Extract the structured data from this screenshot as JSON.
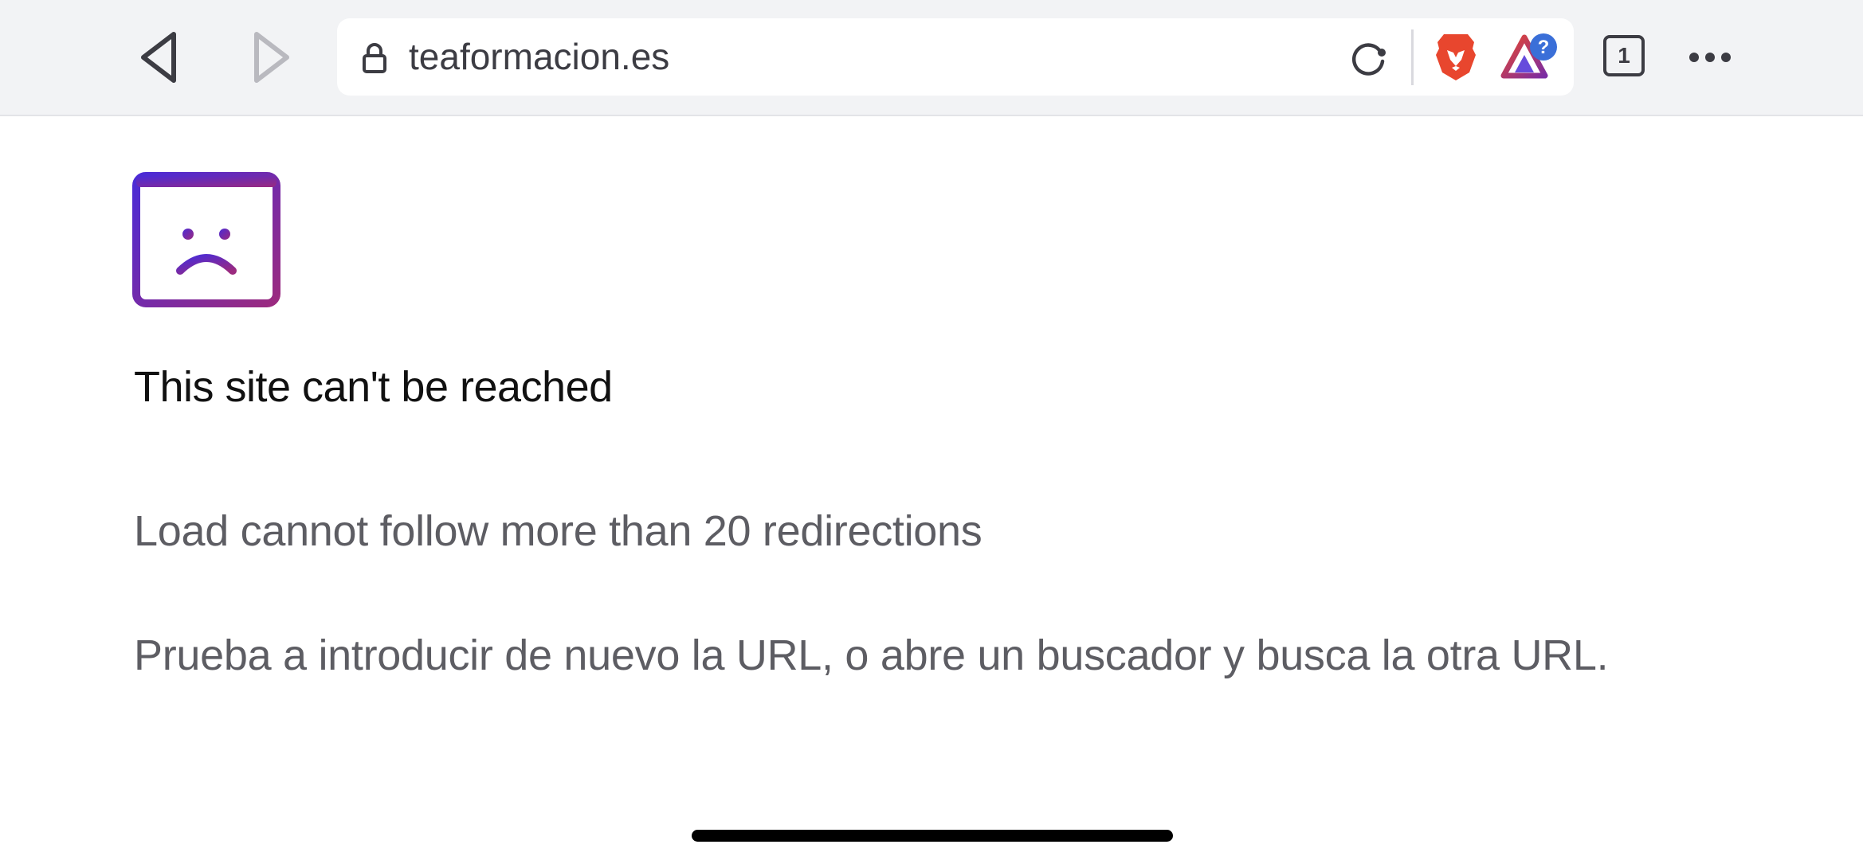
{
  "toolbar": {
    "url": "teaformacion.es",
    "tab_count": "1",
    "icons": {
      "back": "back-chevron-icon",
      "forward": "forward-chevron-icon",
      "lock": "lock-icon",
      "reload": "reload-icon",
      "shields": "brave-lion-icon",
      "rewards": "brave-rewards-triangle-icon",
      "menu": "more-dots-icon"
    },
    "rewards_badge": "?"
  },
  "error": {
    "icon": "sad-browser-window-icon",
    "title": "This site can't be reached",
    "detail": "Load cannot follow more than 20 redirections",
    "hint": "Prueba a introducir de nuevo la URL, o abre un buscador y busca la otra URL."
  },
  "colors": {
    "toolbar_bg": "#f2f3f5",
    "brand_orange": "#e8462e",
    "icon_gradient_start": "#4b2bd6",
    "icon_gradient_end": "#9b2a7f",
    "rewards_badge_blue": "#3a6fd8"
  }
}
